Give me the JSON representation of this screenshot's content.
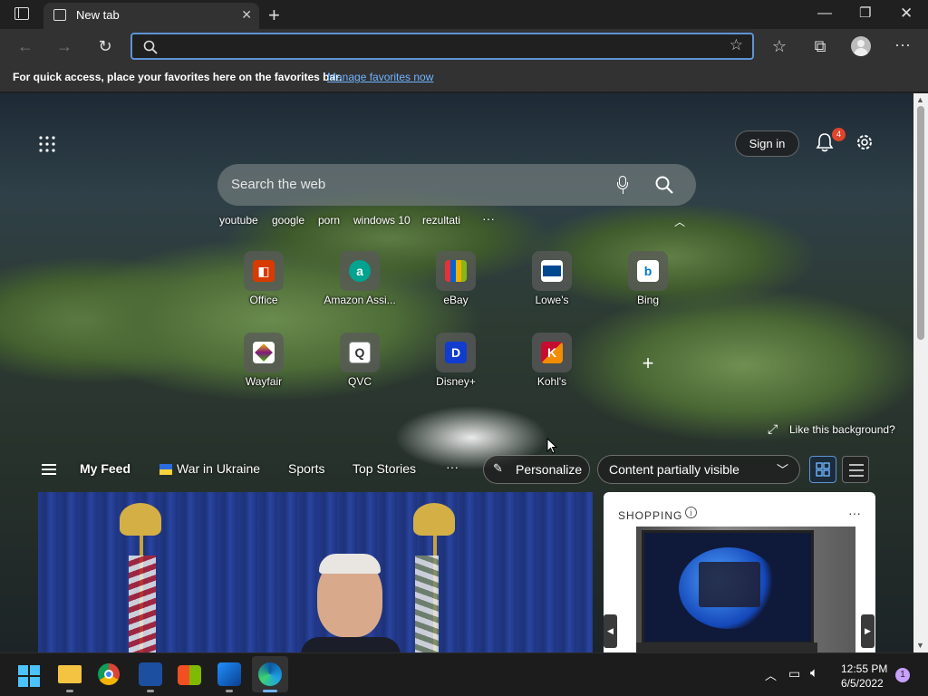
{
  "browser": {
    "tab_title": "New tab",
    "favorites_message": "For quick access, place your favorites here on the favorites bar.",
    "favorites_link": "Manage favorites now",
    "address_value": ""
  },
  "header": {
    "sign_in": "Sign in",
    "notification_count": "4"
  },
  "search": {
    "placeholder": "Search the web",
    "quick_links": [
      "youtube",
      "google",
      "porn",
      "windows 10",
      "rezultati"
    ],
    "more": "···"
  },
  "tiles": [
    {
      "label": "Office",
      "color": "#d83b01",
      "glyph": "◧"
    },
    {
      "label": "Amazon Assi...",
      "color": "#00a38f",
      "glyph": "a"
    },
    {
      "label": "eBay",
      "color": "#e53238",
      "glyph": "▦"
    },
    {
      "label": "Lowe's",
      "color": "#004990",
      "glyph": "▭"
    },
    {
      "label": "Bing",
      "color": "#0078d4",
      "glyph": "b"
    },
    {
      "label": "Wayfair",
      "color": "#7f187f",
      "glyph": "✦"
    },
    {
      "label": "QVC",
      "color": "#ffffff",
      "glyph": "Q"
    },
    {
      "label": "Disney+",
      "color": "#113ccf",
      "glyph": "D"
    },
    {
      "label": "Kohl's",
      "color": "#c60c30",
      "glyph": "K"
    }
  ],
  "background": {
    "like_text": "Like this background?"
  },
  "feed": {
    "my_feed": "My Feed",
    "tabs": [
      "War in Ukraine",
      "Sports",
      "Top Stories"
    ],
    "more": "···",
    "personalize": "Personalize",
    "visibility": "Content partially visible"
  },
  "shopping": {
    "title": "SHOPPING",
    "more": "···"
  },
  "taskbar": {
    "time": "12:55 PM",
    "date": "6/5/2022",
    "badge": "1"
  }
}
